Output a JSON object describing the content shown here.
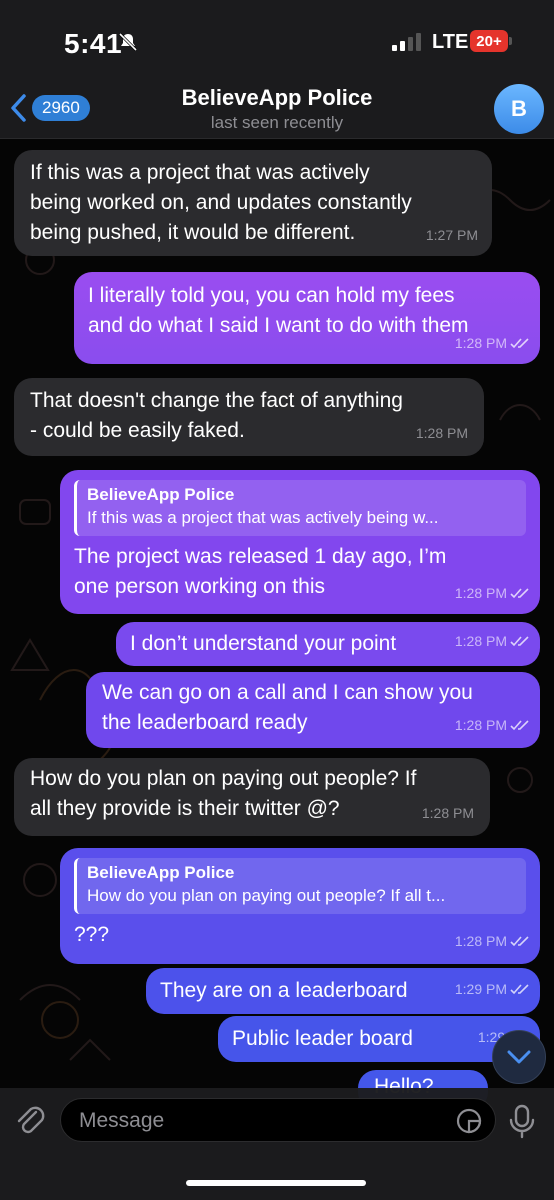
{
  "status_bar": {
    "time": "5:41",
    "network": "LTE",
    "battery": "20+"
  },
  "header": {
    "back_badge": "2960",
    "title": "BelieveApp Police",
    "subtitle": "last seen recently",
    "avatar_initial": "B"
  },
  "messages": [
    {
      "dir": "in",
      "text": "If this was a project that was actively\nbeing worked on, and updates constantly\nbeing pushed, it would be different.",
      "time": "1:27 PM"
    },
    {
      "dir": "out",
      "text": "I literally told you, you can hold my fees\nand do what I said I want to do with them",
      "time": "1:28 PM"
    },
    {
      "dir": "in",
      "text": "That doesn't change the fact of anything\n- could be easily faked.",
      "time": "1:28 PM"
    },
    {
      "dir": "out",
      "reply_name": "BelieveApp Police",
      "reply_text": "If this was a project that was actively being w...",
      "text": "The project was released 1 day ago, I’m\none person working on this",
      "time": "1:28 PM"
    },
    {
      "dir": "out",
      "text": "I don’t understand your point",
      "time": "1:28 PM"
    },
    {
      "dir": "out",
      "text": "We can go on a call and I can show you\nthe leaderboard ready",
      "time": "1:28 PM"
    },
    {
      "dir": "in",
      "text": "How do you plan on paying out people? If\nall they provide is their twitter @?",
      "time": "1:28 PM"
    },
    {
      "dir": "out",
      "reply_name": "BelieveApp Police",
      "reply_text": "How do you plan on paying out people? If all t...",
      "text": "???",
      "time": "1:28 PM"
    },
    {
      "dir": "out",
      "text": "They are on a leaderboard",
      "time": "1:29 PM"
    },
    {
      "dir": "out",
      "text": "Public leader board",
      "time": "1:29 PM"
    },
    {
      "dir": "out",
      "text": "Hello?",
      "time": ""
    }
  ],
  "input": {
    "placeholder": "Message"
  },
  "colors": {
    "out_top": "#8a4dee",
    "out_bottom": "#4457ea",
    "incoming": "#2b2b2e",
    "accent": "#2f7fd6"
  },
  "icons": [
    "mute-icon",
    "signal-icon",
    "back-chevron-icon",
    "attach-icon",
    "sticker-icon",
    "mic-icon",
    "chevron-down-icon",
    "double-check-icon"
  ]
}
